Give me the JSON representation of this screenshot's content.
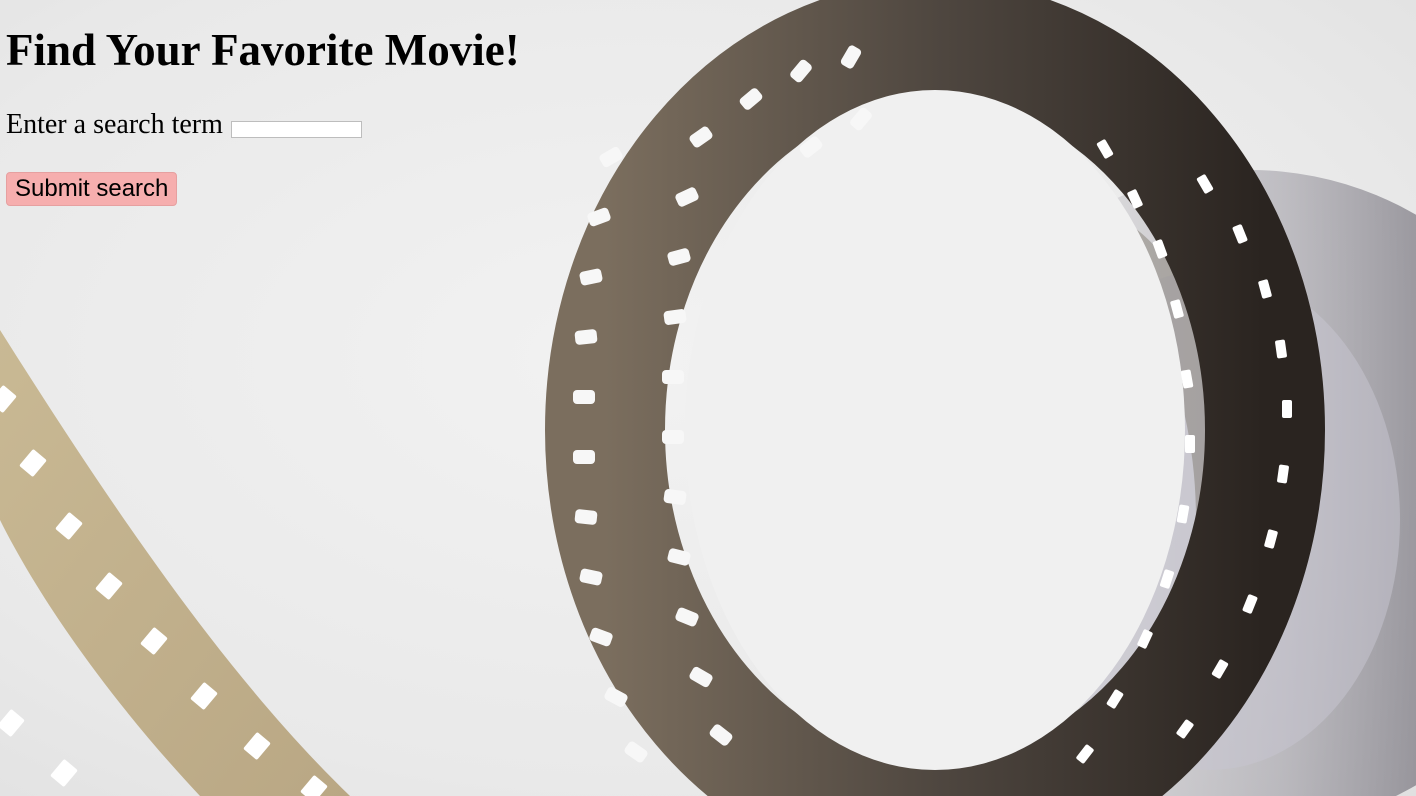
{
  "page": {
    "title": "Find Your Favorite Movie!",
    "background_image": "film-reel-photo"
  },
  "search": {
    "label": "Enter a search term",
    "value": "",
    "placeholder": ""
  },
  "submit": {
    "label": "Submit search",
    "color": "#f6aeae"
  }
}
